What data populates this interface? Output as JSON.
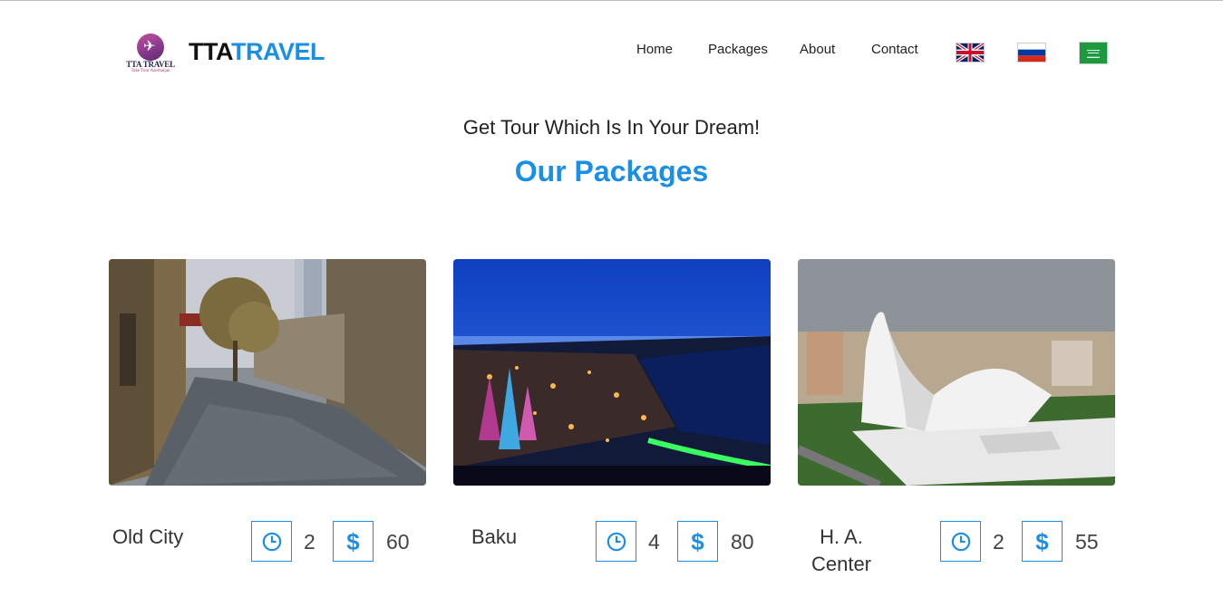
{
  "brand": {
    "logo_text": "TTA TRAVEL",
    "logo_tagline": "Take Tour Azerbaijan",
    "name_part1": "TTA",
    "name_part2": "TRAVEL"
  },
  "nav": {
    "items": [
      {
        "label": "Home"
      },
      {
        "label": "Packages"
      },
      {
        "label": "About"
      },
      {
        "label": "Contact"
      }
    ],
    "languages": [
      {
        "icon": "uk-flag-icon"
      },
      {
        "icon": "russia-flag-icon"
      },
      {
        "icon": "saudi-flag-icon"
      }
    ]
  },
  "hero": {
    "subtitle": "Get Tour Which Is In Your Dream!",
    "title": "Our Packages"
  },
  "packages": [
    {
      "name": "Old City",
      "duration": "2",
      "price": "60"
    },
    {
      "name": "Baku",
      "duration": "4",
      "price": "80"
    },
    {
      "name": "H. A. Center",
      "duration": "2",
      "price": "55"
    }
  ],
  "icons": {
    "duration": "clock-icon",
    "price": "dollar-icon",
    "dollar_glyph": "$"
  },
  "colors": {
    "accent": "#1a8fe6",
    "text": "#222222"
  }
}
